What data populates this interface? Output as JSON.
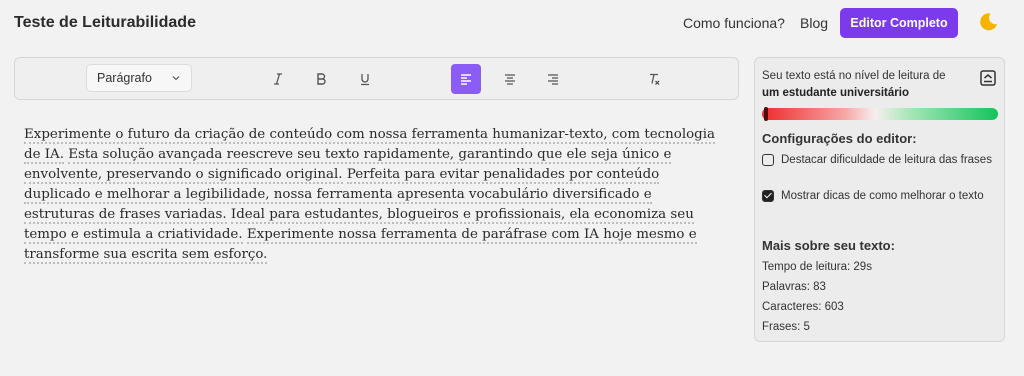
{
  "header": {
    "title": "Teste de Leiturabilidade",
    "nav": [
      "Como funciona?",
      "Blog"
    ],
    "cta_label": "Editor Completo",
    "theme_icon": "moon-icon",
    "accent": "#7c3aed",
    "theme_icon_color": "#f5b400"
  },
  "toolbar": {
    "block_style": "Parágrafo",
    "buttons": [
      {
        "name": "italic-button",
        "glyph": "I",
        "icon": "italic-icon"
      },
      {
        "name": "bold-button",
        "glyph": "B",
        "icon": "bold-icon"
      },
      {
        "name": "underline-button",
        "glyph": "U",
        "icon": "underline-icon"
      },
      {
        "name": "align-left-button",
        "icon": "align-left-icon",
        "active": true
      },
      {
        "name": "align-center-button",
        "icon": "align-center-icon"
      },
      {
        "name": "align-right-button",
        "icon": "align-right-icon"
      },
      {
        "name": "clear-format-button",
        "glyph": "Tx",
        "icon": "clear-format-icon"
      }
    ],
    "active_color": "#8b5cf6"
  },
  "editor": {
    "sentences": [
      "Experimente o futuro da criação de conteúdo com nossa ferramenta humanizar-texto, com tecnologia de IA.",
      "Esta solução avançada reescreve seu texto rapidamente, garantindo que ele seja único e envolvente, preservando o significado original.",
      "Perfeita para evitar penalidades por conteúdo duplicado e melhorar a legibilidade, nossa ferramenta apresenta vocabulário diversificado e estruturas de frases variadas.",
      "Ideal para estudantes, blogueiros e profissionais, ela economiza seu tempo e estimula a criatividade.",
      "Experimente nossa ferramenta de paráfrase com IA hoje mesmo e transforme sua escrita sem esforço."
    ]
  },
  "panel": {
    "level_prefix": "Seu texto está no nível de leitura de",
    "level_value": "um estudante universitário",
    "level_position": 0.01,
    "config_title": "Configurações do editor:",
    "options": [
      {
        "label": "Destacar dificuldade de leitura das frases",
        "checked": false
      },
      {
        "label": "Mostrar dicas de como melhorar o texto",
        "checked": true
      }
    ],
    "stats_title": "Mais sobre seu texto:",
    "stats": [
      "Tempo de leitura: 29s",
      "Palavras: 83",
      "Caracteres: 603",
      "Frases: 5"
    ]
  }
}
